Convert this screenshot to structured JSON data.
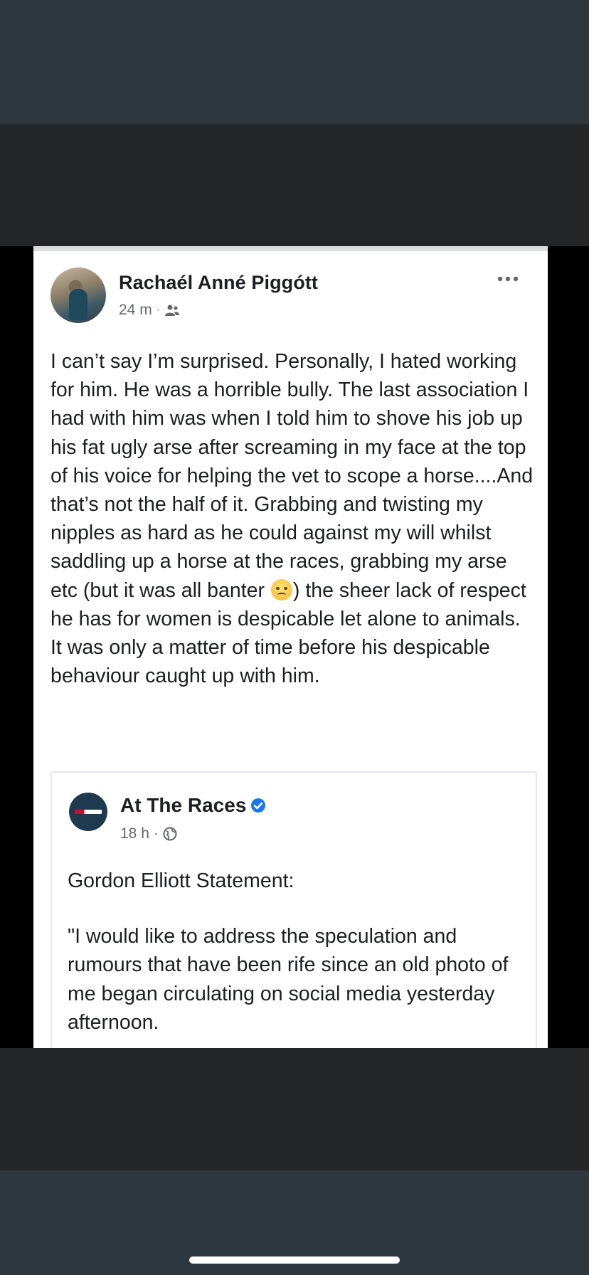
{
  "post": {
    "author": "Rachaél Anné Piggótt",
    "time": "24 m",
    "separator": "·",
    "body_before_emoji": "I can’t say I’m surprised. Personally, I hated working for him. He was a horrible bully. The last association I had with him was when I told him to shove his job up his fat ugly arse after screaming in my face at the top of his voice for helping the vet to scope a horse....And that’s not the half of it. Grabbing and twisting my nipples as hard as he could against my will whilst saddling up a horse at the races, grabbing my arse etc (but it was all banter ",
    "body_after_emoji": ") the sheer lack of respect he has for women is despicable let alone to animals. It was only a matter of time before his despicable behaviour caught up with him.",
    "emoji_icon": "rolling-eyes-emoji",
    "audience_icon": "friends-icon",
    "more_icon": "more-dots-icon"
  },
  "shared_post": {
    "author": "At The Races",
    "verified_icon": "verified-badge-icon",
    "time": "18 h",
    "separator": "·",
    "audience_icon": "globe-icon",
    "title_line": "Gordon Elliott Statement:",
    "quote": "\"I would like to address the speculation and rumours that have been rife since an old photo of me began circulating on social media yesterday afternoon."
  },
  "colors": {
    "text": "#1c1e21",
    "secondary": "#65676b",
    "verified": "#1877f2",
    "background_band": "#2f373e"
  }
}
